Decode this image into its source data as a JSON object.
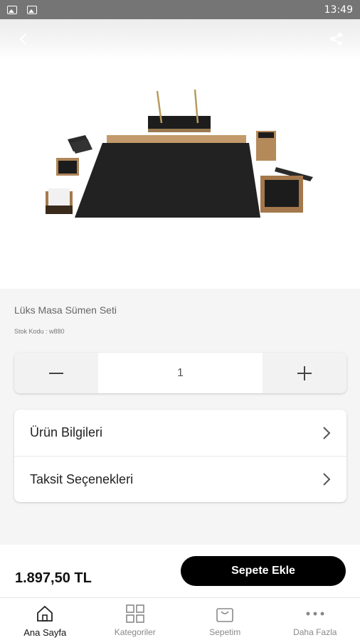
{
  "status_bar": {
    "time": "13:49"
  },
  "product": {
    "title": "Lüks Masa Sümen Seti",
    "stock_code": "Stok Kodu : w880",
    "quantity": "1",
    "price": "1.897,50 TL"
  },
  "menu": {
    "items": [
      {
        "label": "Ürün Bilgileri"
      },
      {
        "label": "Taksit Seçenekleri"
      }
    ]
  },
  "actions": {
    "add_to_cart": "Sepete Ekle"
  },
  "bottom_nav": {
    "items": [
      {
        "label": "Ana Sayfa",
        "icon": "home-icon",
        "active": true
      },
      {
        "label": "Kategoriler",
        "icon": "grid-icon",
        "active": false
      },
      {
        "label": "Sepetim",
        "icon": "cart-icon",
        "active": false
      },
      {
        "label": "Daha Fazla",
        "icon": "more-icon",
        "active": false
      }
    ]
  }
}
